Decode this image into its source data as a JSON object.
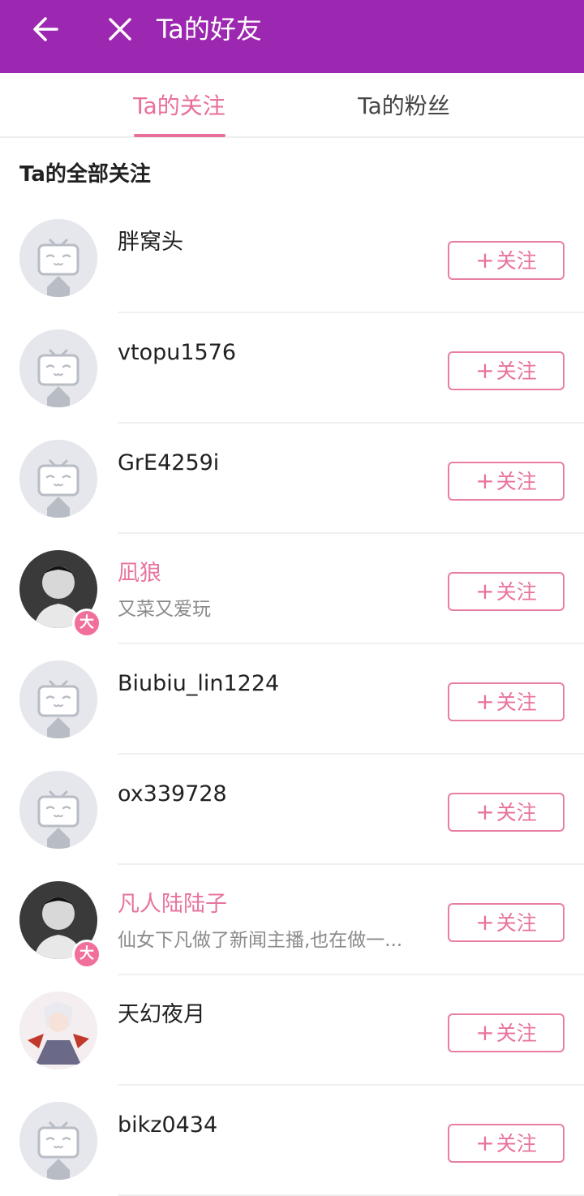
{
  "appbar": {
    "title": "Ta的好友",
    "back_icon": "arrow-left-icon",
    "close_icon": "close-icon",
    "color": "#9c27b0"
  },
  "tabs": [
    {
      "label": "Ta的关注",
      "active": true
    },
    {
      "label": "Ta的粉丝",
      "active": false
    }
  ],
  "accent_color": "#e86e9b",
  "section_title": "Ta的全部关注",
  "follow_label": "关注",
  "users": [
    {
      "name": "胖窝头",
      "signature": "",
      "avatar": "default-tv-avatar",
      "vip": false
    },
    {
      "name": "vtopu1576",
      "signature": "",
      "avatar": "default-tv-avatar",
      "vip": false
    },
    {
      "name": "GrE4259i",
      "signature": "",
      "avatar": "default-tv-avatar",
      "vip": false
    },
    {
      "name": "凪狼",
      "signature": "又菜又爱玩",
      "avatar": "photo-avatar",
      "vip": true,
      "vip_label": "大"
    },
    {
      "name": "Biubiu_lin1224",
      "signature": "",
      "avatar": "default-tv-avatar",
      "vip": false
    },
    {
      "name": "ox339728",
      "signature": "",
      "avatar": "default-tv-avatar",
      "vip": false
    },
    {
      "name": "凡人陆陆子",
      "signature": "仙女下凡做了新闻主播,也在做一...",
      "avatar": "photo-avatar",
      "vip": true,
      "vip_label": "大"
    },
    {
      "name": "天幻夜月",
      "signature": "",
      "avatar": "anime-avatar",
      "vip": false
    },
    {
      "name": "bikz0434",
      "signature": "",
      "avatar": "default-tv-avatar",
      "vip": false
    }
  ]
}
